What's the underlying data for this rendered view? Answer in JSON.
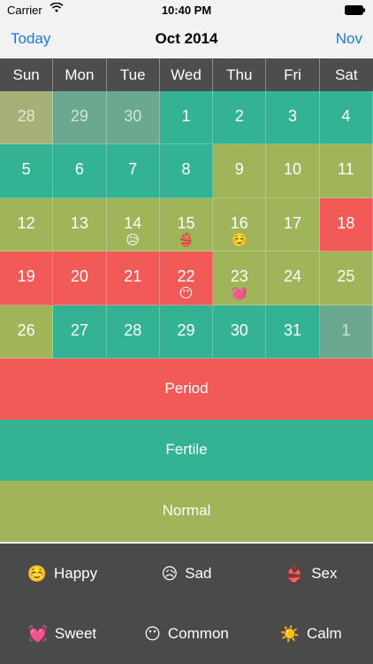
{
  "status": {
    "carrier": "Carrier",
    "time": "10:40 PM"
  },
  "nav": {
    "left": "Today",
    "title": "Oct  2014",
    "right": "Nov"
  },
  "weekdays": [
    "Sun",
    "Mon",
    "Tue",
    "Wed",
    "Thu",
    "Fri",
    "Sat"
  ],
  "colors": {
    "period": "#f25a57",
    "fertile": "#34b394",
    "normal": "#a0b55a",
    "out_fertile": "#6aa890",
    "out_normal": "#a8b07a"
  },
  "days": [
    {
      "n": "28",
      "t": "normal",
      "out": true
    },
    {
      "n": "29",
      "t": "fertile",
      "out": true
    },
    {
      "n": "30",
      "t": "fertile",
      "out": true
    },
    {
      "n": "1",
      "t": "fertile"
    },
    {
      "n": "2",
      "t": "fertile"
    },
    {
      "n": "3",
      "t": "fertile"
    },
    {
      "n": "4",
      "t": "fertile"
    },
    {
      "n": "5",
      "t": "fertile"
    },
    {
      "n": "6",
      "t": "fertile"
    },
    {
      "n": "7",
      "t": "fertile"
    },
    {
      "n": "8",
      "t": "fertile"
    },
    {
      "n": "9",
      "t": "normal"
    },
    {
      "n": "10",
      "t": "normal"
    },
    {
      "n": "11",
      "t": "normal"
    },
    {
      "n": "12",
      "t": "normal"
    },
    {
      "n": "13",
      "t": "normal"
    },
    {
      "n": "14",
      "t": "normal",
      "mood": "😥"
    },
    {
      "n": "15",
      "t": "normal",
      "mood": "👙"
    },
    {
      "n": "16",
      "t": "normal",
      "mood": "☺️"
    },
    {
      "n": "17",
      "t": "normal"
    },
    {
      "n": "18",
      "t": "period"
    },
    {
      "n": "19",
      "t": "period"
    },
    {
      "n": "20",
      "t": "period"
    },
    {
      "n": "21",
      "t": "period"
    },
    {
      "n": "22",
      "t": "period",
      "mood": "😶"
    },
    {
      "n": "23",
      "t": "normal",
      "mood": "💓"
    },
    {
      "n": "24",
      "t": "normal"
    },
    {
      "n": "25",
      "t": "normal"
    },
    {
      "n": "26",
      "t": "normal"
    },
    {
      "n": "27",
      "t": "fertile"
    },
    {
      "n": "28",
      "t": "fertile"
    },
    {
      "n": "29",
      "t": "fertile"
    },
    {
      "n": "30",
      "t": "fertile"
    },
    {
      "n": "31",
      "t": "fertile"
    },
    {
      "n": "1",
      "t": "fertile",
      "out": true
    }
  ],
  "legend": {
    "period": "Period",
    "fertile": "Fertile",
    "normal": "Normal"
  },
  "moods": [
    {
      "icon": "☺️",
      "label": "Happy",
      "name": "happy"
    },
    {
      "icon": "😥",
      "label": "Sad",
      "name": "sad"
    },
    {
      "icon": "👙",
      "label": "Sex",
      "name": "sex"
    },
    {
      "icon": "💓",
      "label": "Sweet",
      "name": "sweet"
    },
    {
      "icon": "😶",
      "label": "Common",
      "name": "common"
    },
    {
      "icon": "☀️",
      "label": "Calm",
      "name": "calm"
    }
  ]
}
